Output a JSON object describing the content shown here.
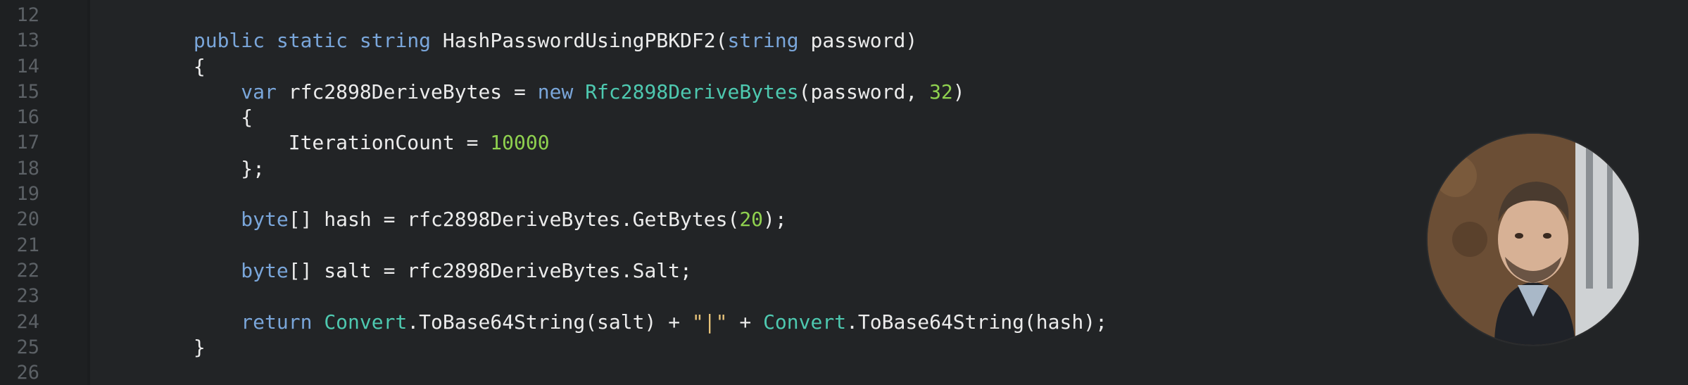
{
  "editor": {
    "lines": [
      {
        "number": "12",
        "tokens": []
      },
      {
        "number": "13",
        "tokens": [
          {
            "t": "        ",
            "c": "plain"
          },
          {
            "t": "public",
            "c": "kw"
          },
          {
            "t": " ",
            "c": "plain"
          },
          {
            "t": "static",
            "c": "kw"
          },
          {
            "t": " ",
            "c": "plain"
          },
          {
            "t": "string",
            "c": "kw"
          },
          {
            "t": " HashPasswordUsingPBKDF2(",
            "c": "plain"
          },
          {
            "t": "string",
            "c": "kw"
          },
          {
            "t": " password)",
            "c": "plain"
          }
        ]
      },
      {
        "number": "14",
        "tokens": [
          {
            "t": "        {",
            "c": "plain"
          }
        ]
      },
      {
        "number": "15",
        "tokens": [
          {
            "t": "            ",
            "c": "plain"
          },
          {
            "t": "var",
            "c": "kw"
          },
          {
            "t": " rfc2898DeriveBytes = ",
            "c": "plain"
          },
          {
            "t": "new",
            "c": "kw"
          },
          {
            "t": " ",
            "c": "plain"
          },
          {
            "t": "Rfc2898DeriveBytes",
            "c": "ty"
          },
          {
            "t": "(password, ",
            "c": "plain"
          },
          {
            "t": "32",
            "c": "num"
          },
          {
            "t": ")",
            "c": "plain"
          }
        ]
      },
      {
        "number": "16",
        "tokens": [
          {
            "t": "            {",
            "c": "plain"
          }
        ]
      },
      {
        "number": "17",
        "tokens": [
          {
            "t": "                IterationCount = ",
            "c": "plain"
          },
          {
            "t": "10000",
            "c": "num"
          }
        ]
      },
      {
        "number": "18",
        "tokens": [
          {
            "t": "            };",
            "c": "plain"
          }
        ]
      },
      {
        "number": "19",
        "tokens": []
      },
      {
        "number": "20",
        "tokens": [
          {
            "t": "            ",
            "c": "plain"
          },
          {
            "t": "byte",
            "c": "kw"
          },
          {
            "t": "[] hash = rfc2898DeriveBytes.GetBytes(",
            "c": "plain"
          },
          {
            "t": "20",
            "c": "num"
          },
          {
            "t": ");",
            "c": "plain"
          }
        ]
      },
      {
        "number": "21",
        "tokens": []
      },
      {
        "number": "22",
        "tokens": [
          {
            "t": "            ",
            "c": "plain"
          },
          {
            "t": "byte",
            "c": "kw"
          },
          {
            "t": "[] salt = rfc2898DeriveBytes.Salt;",
            "c": "plain"
          }
        ]
      },
      {
        "number": "23",
        "tokens": []
      },
      {
        "number": "24",
        "tokens": [
          {
            "t": "            ",
            "c": "plain"
          },
          {
            "t": "return",
            "c": "kw"
          },
          {
            "t": " ",
            "c": "plain"
          },
          {
            "t": "Convert",
            "c": "ty"
          },
          {
            "t": ".ToBase64String(salt) + ",
            "c": "plain"
          },
          {
            "t": "\"|\"",
            "c": "str"
          },
          {
            "t": " + ",
            "c": "plain"
          },
          {
            "t": "Convert",
            "c": "ty"
          },
          {
            "t": ".ToBase64String(hash);",
            "c": "plain"
          }
        ]
      },
      {
        "number": "25",
        "tokens": [
          {
            "t": "        }",
            "c": "plain"
          }
        ]
      },
      {
        "number": "26",
        "tokens": []
      }
    ]
  },
  "colors": {
    "background": "#222426",
    "gutter": "#1e2022",
    "keyword": "#7aa6da",
    "type": "#4ec9b0",
    "number": "#8fd14f",
    "string": "#e6c27a",
    "line_number": "#5c6166"
  },
  "avatar": {
    "icon": "speaker-photo"
  }
}
